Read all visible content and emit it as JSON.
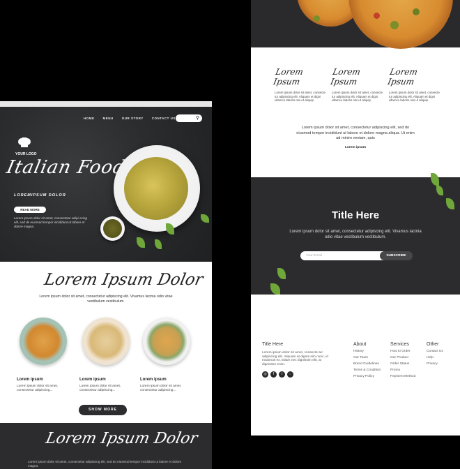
{
  "left": {
    "nav": [
      "HOME",
      "MENU",
      "OUR STORY",
      "CONTACT US"
    ],
    "logo_text": "YOUR LOGO",
    "hero_title": "Italian Food",
    "hero_subtitle": "LOREMIPSUM DOLOR",
    "read_more": "READ MORE",
    "hero_text": "Lorem ipsum dolor sit amet, consectetur adipi-scing elit, sed do eiusmod tempor incididunt ut labore et dolore magna.",
    "section_title": "Lorem Ipsum Dolor",
    "section_text": "Lorem ipsum dolor sit amet, consectetur adipiscing elit. Vivamus lacinia odio vitae vestibulum vestibulum.",
    "cards": [
      {
        "title": "Lorem ipsum",
        "text": "Lorem ipsum dolor sit amet, consectetur adipiscing..."
      },
      {
        "title": "Lorem ipsum",
        "text": "Lorem ipsum dolor sit amet, consectetur adipiscing..."
      },
      {
        "title": "Lorem ipsum",
        "text": "Lorem ipsum dolor sit amet, consectetur adipiscing..."
      }
    ],
    "show_more": "SHOW MORE",
    "dark_title": "Lorem Ipsum Dolor",
    "dark_text": "Lorem ipsum dolor sit amet, consectetur adipiscing elit, sed do eiusmod tempor incididunt ut labore et dolore magna."
  },
  "right": {
    "columns": [
      {
        "title": "Lorem Ipsum",
        "text": "Lorem ipsum dolor sit amet, consecte tur adipiscing elit. Aliquam et digni ullamco laboris nisi ut aliquip."
      },
      {
        "title": "Lorem Ipsum",
        "text": "Lorem ipsum dolor sit amet, consecte tur adipiscing elit. Aliquam et digni ullamco laboris nisi ut aliquip."
      },
      {
        "title": "Lorem Ipsum",
        "text": "Lorem ipsum dolor sit amet, consecte tur adipiscing elit. Aliquam et digni ullamco laboris nisi ut aliquip."
      }
    ],
    "mid_text": "Lorem ipsum dolor sit amet, consectetur adipiscing elit, sed do eiusmod tempor incididunt ut labore et dolore magna aliqua. Ut enim ad minim veniam, quis",
    "mid_small": "Lorem ipsum",
    "subscribe_title": "Title Here",
    "subscribe_text": "Lorem ipsum dolor sit amet, consectetur adipiscing elit. Vivamus lacinia odio vitae vestibulum vestibulum.",
    "email_placeholder": "Your Email",
    "subscribe_button": "SUBSCRIBE",
    "footer": {
      "title": "Title Here",
      "about_text": "Lorem ipsum dolor sit amet, consecte-tur adipiscing elit. Aliquam at dignis-sim nunc, id maximus ex. Etiam nec dignissim elit, at dignissim enim.",
      "about": {
        "heading": "About",
        "links": [
          "History",
          "Our Team",
          "Brand Guidelines",
          "Terms & Condition",
          "Privacy Policy"
        ]
      },
      "services": {
        "heading": "Services",
        "links": [
          "How to Order",
          "Our Product",
          "Order Status",
          "Promo",
          "Payment Method"
        ]
      },
      "other": {
        "heading": "Other",
        "links": [
          "Contact Us",
          "Help",
          "Privacy"
        ]
      },
      "social_icons": [
        "instagram-icon",
        "facebook-icon",
        "twitter-icon",
        "whatsapp-icon"
      ]
    }
  },
  "colors": {
    "dark": "#2c2c2e",
    "leaf": "#6fa73a",
    "pasta": "#b4a23a"
  }
}
